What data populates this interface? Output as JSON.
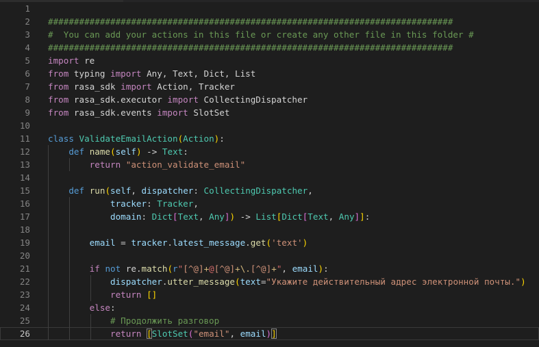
{
  "editor": {
    "active_line": 26,
    "lines": [
      {
        "n": "1",
        "indent": 0,
        "tokens": []
      },
      {
        "n": "2",
        "indent": 0,
        "tokens": [
          {
            "t": "##############################################################################",
            "c": "cmt"
          }
        ]
      },
      {
        "n": "3",
        "indent": 0,
        "tokens": [
          {
            "t": "#  You can add your actions in this file or create any other file in this folder #",
            "c": "cmt"
          }
        ]
      },
      {
        "n": "4",
        "indent": 0,
        "tokens": [
          {
            "t": "##############################################################################",
            "c": "cmt"
          }
        ]
      },
      {
        "n": "5",
        "indent": 0,
        "tokens": [
          {
            "t": "import",
            "c": "kwc"
          },
          {
            "t": " re",
            "c": "txt"
          }
        ]
      },
      {
        "n": "6",
        "indent": 0,
        "tokens": [
          {
            "t": "from",
            "c": "kwc"
          },
          {
            "t": " typing ",
            "c": "txt"
          },
          {
            "t": "import",
            "c": "kwc"
          },
          {
            "t": " Any, Text, Dict, List",
            "c": "txt"
          }
        ]
      },
      {
        "n": "7",
        "indent": 0,
        "tokens": [
          {
            "t": "from",
            "c": "kwc"
          },
          {
            "t": " rasa_sdk ",
            "c": "txt"
          },
          {
            "t": "import",
            "c": "kwc"
          },
          {
            "t": " Action, Tracker",
            "c": "txt"
          }
        ]
      },
      {
        "n": "8",
        "indent": 0,
        "tokens": [
          {
            "t": "from",
            "c": "kwc"
          },
          {
            "t": " rasa_sdk.executor ",
            "c": "txt"
          },
          {
            "t": "import",
            "c": "kwc"
          },
          {
            "t": " CollectingDispatcher",
            "c": "txt"
          }
        ]
      },
      {
        "n": "9",
        "indent": 0,
        "tokens": [
          {
            "t": "from",
            "c": "kwc"
          },
          {
            "t": " rasa_sdk.events ",
            "c": "txt"
          },
          {
            "t": "import",
            "c": "kwc"
          },
          {
            "t": " SlotSet",
            "c": "txt"
          }
        ]
      },
      {
        "n": "10",
        "indent": 0,
        "tokens": []
      },
      {
        "n": "11",
        "indent": 0,
        "tokens": [
          {
            "t": "class",
            "c": "kw"
          },
          {
            "t": " ",
            "c": "txt"
          },
          {
            "t": "ValidateEmailAction",
            "c": "cls"
          },
          {
            "t": "(",
            "c": "p1"
          },
          {
            "t": "Action",
            "c": "cls"
          },
          {
            "t": ")",
            "c": "p1"
          },
          {
            "t": ":",
            "c": "txt"
          }
        ]
      },
      {
        "n": "12",
        "indent": 1,
        "tokens": [
          {
            "t": "    ",
            "c": "txt"
          },
          {
            "t": "def",
            "c": "kw"
          },
          {
            "t": " ",
            "c": "txt"
          },
          {
            "t": "name",
            "c": "fn"
          },
          {
            "t": "(",
            "c": "p1"
          },
          {
            "t": "self",
            "c": "var"
          },
          {
            "t": ")",
            "c": "p1"
          },
          {
            "t": " -> ",
            "c": "txt"
          },
          {
            "t": "Text",
            "c": "cls"
          },
          {
            "t": ":",
            "c": "txt"
          }
        ]
      },
      {
        "n": "13",
        "indent": 2,
        "tokens": [
          {
            "t": "        ",
            "c": "txt"
          },
          {
            "t": "return",
            "c": "kwc"
          },
          {
            "t": " ",
            "c": "txt"
          },
          {
            "t": "\"action_validate_email\"",
            "c": "str"
          }
        ]
      },
      {
        "n": "14",
        "indent": 1,
        "tokens": []
      },
      {
        "n": "15",
        "indent": 1,
        "tokens": [
          {
            "t": "    ",
            "c": "txt"
          },
          {
            "t": "def",
            "c": "kw"
          },
          {
            "t": " ",
            "c": "txt"
          },
          {
            "t": "run",
            "c": "fn"
          },
          {
            "t": "(",
            "c": "p1"
          },
          {
            "t": "self",
            "c": "var"
          },
          {
            "t": ", ",
            "c": "txt"
          },
          {
            "t": "dispatcher",
            "c": "var"
          },
          {
            "t": ": ",
            "c": "txt"
          },
          {
            "t": "CollectingDispatcher",
            "c": "cls"
          },
          {
            "t": ",",
            "c": "txt"
          }
        ]
      },
      {
        "n": "16",
        "indent": 2,
        "tokens": [
          {
            "t": "            ",
            "c": "txt"
          },
          {
            "t": "tracker",
            "c": "var"
          },
          {
            "t": ": ",
            "c": "txt"
          },
          {
            "t": "Tracker",
            "c": "cls"
          },
          {
            "t": ",",
            "c": "txt"
          }
        ]
      },
      {
        "n": "17",
        "indent": 2,
        "tokens": [
          {
            "t": "            ",
            "c": "txt"
          },
          {
            "t": "domain",
            "c": "var"
          },
          {
            "t": ": ",
            "c": "txt"
          },
          {
            "t": "Dict",
            "c": "cls"
          },
          {
            "t": "[",
            "c": "p2"
          },
          {
            "t": "Text",
            "c": "cls"
          },
          {
            "t": ", ",
            "c": "txt"
          },
          {
            "t": "Any",
            "c": "cls"
          },
          {
            "t": "]",
            "c": "p2"
          },
          {
            "t": ")",
            "c": "p1"
          },
          {
            "t": " -> ",
            "c": "txt"
          },
          {
            "t": "List",
            "c": "cls"
          },
          {
            "t": "[",
            "c": "p1"
          },
          {
            "t": "Dict",
            "c": "cls"
          },
          {
            "t": "[",
            "c": "p2"
          },
          {
            "t": "Text",
            "c": "cls"
          },
          {
            "t": ", ",
            "c": "txt"
          },
          {
            "t": "Any",
            "c": "cls"
          },
          {
            "t": "]",
            "c": "p2"
          },
          {
            "t": "]",
            "c": "p1"
          },
          {
            "t": ":",
            "c": "txt"
          }
        ]
      },
      {
        "n": "18",
        "indent": 2,
        "tokens": []
      },
      {
        "n": "19",
        "indent": 2,
        "tokens": [
          {
            "t": "        ",
            "c": "txt"
          },
          {
            "t": "email",
            "c": "var"
          },
          {
            "t": " = ",
            "c": "txt"
          },
          {
            "t": "tracker",
            "c": "var"
          },
          {
            "t": ".",
            "c": "txt"
          },
          {
            "t": "latest_message",
            "c": "var"
          },
          {
            "t": ".",
            "c": "txt"
          },
          {
            "t": "get",
            "c": "fn"
          },
          {
            "t": "(",
            "c": "p1"
          },
          {
            "t": "'text'",
            "c": "str"
          },
          {
            "t": ")",
            "c": "p1"
          }
        ]
      },
      {
        "n": "20",
        "indent": 2,
        "tokens": []
      },
      {
        "n": "21",
        "indent": 2,
        "tokens": [
          {
            "t": "        ",
            "c": "txt"
          },
          {
            "t": "if",
            "c": "kwc"
          },
          {
            "t": " ",
            "c": "txt"
          },
          {
            "t": "not",
            "c": "kw"
          },
          {
            "t": " re",
            "c": "txt"
          },
          {
            "t": ".",
            "c": "txt"
          },
          {
            "t": "match",
            "c": "fn"
          },
          {
            "t": "(",
            "c": "p1"
          },
          {
            "t": "r",
            "c": "kw"
          },
          {
            "t": "\"",
            "c": "re"
          },
          {
            "t": "[^@]",
            "c": "str"
          },
          {
            "t": "+",
            "c": "esc"
          },
          {
            "t": "@",
            "c": "re"
          },
          {
            "t": "[^@]",
            "c": "str"
          },
          {
            "t": "+",
            "c": "esc"
          },
          {
            "t": "\\.",
            "c": "esc"
          },
          {
            "t": "[^@]",
            "c": "str"
          },
          {
            "t": "+",
            "c": "esc"
          },
          {
            "t": "\"",
            "c": "re"
          },
          {
            "t": ", ",
            "c": "txt"
          },
          {
            "t": "email",
            "c": "var"
          },
          {
            "t": ")",
            "c": "p1"
          },
          {
            "t": ":",
            "c": "txt"
          }
        ]
      },
      {
        "n": "22",
        "indent": 3,
        "tokens": [
          {
            "t": "            ",
            "c": "txt"
          },
          {
            "t": "dispatcher",
            "c": "var"
          },
          {
            "t": ".",
            "c": "txt"
          },
          {
            "t": "utter_message",
            "c": "fn"
          },
          {
            "t": "(",
            "c": "p1"
          },
          {
            "t": "text",
            "c": "var"
          },
          {
            "t": "=",
            "c": "txt"
          },
          {
            "t": "\"Укажите действительный адрес электронной почты.\"",
            "c": "str"
          },
          {
            "t": ")",
            "c": "p1"
          }
        ]
      },
      {
        "n": "23",
        "indent": 3,
        "tokens": [
          {
            "t": "            ",
            "c": "txt"
          },
          {
            "t": "return",
            "c": "kwc"
          },
          {
            "t": " ",
            "c": "txt"
          },
          {
            "t": "[]",
            "c": "p1"
          }
        ]
      },
      {
        "n": "24",
        "indent": 2,
        "tokens": [
          {
            "t": "        ",
            "c": "txt"
          },
          {
            "t": "else",
            "c": "kwc"
          },
          {
            "t": ":",
            "c": "txt"
          }
        ]
      },
      {
        "n": "25",
        "indent": 3,
        "tokens": [
          {
            "t": "            ",
            "c": "txt"
          },
          {
            "t": "# Продолжить разговор",
            "c": "cmt"
          }
        ]
      },
      {
        "n": "26",
        "indent": 3,
        "tokens": [
          {
            "t": "            ",
            "c": "txt"
          },
          {
            "t": "return",
            "c": "kwc"
          },
          {
            "t": " ",
            "c": "txt"
          },
          {
            "t": "[",
            "c": "p1",
            "m": 1
          },
          {
            "t": "SlotSet",
            "c": "cls"
          },
          {
            "t": "(",
            "c": "p2"
          },
          {
            "t": "\"email\"",
            "c": "str"
          },
          {
            "t": ", ",
            "c": "txt"
          },
          {
            "t": "email",
            "c": "var"
          },
          {
            "t": ")",
            "c": "p2"
          },
          {
            "t": "]",
            "c": "p1",
            "m": 1
          }
        ]
      }
    ]
  }
}
